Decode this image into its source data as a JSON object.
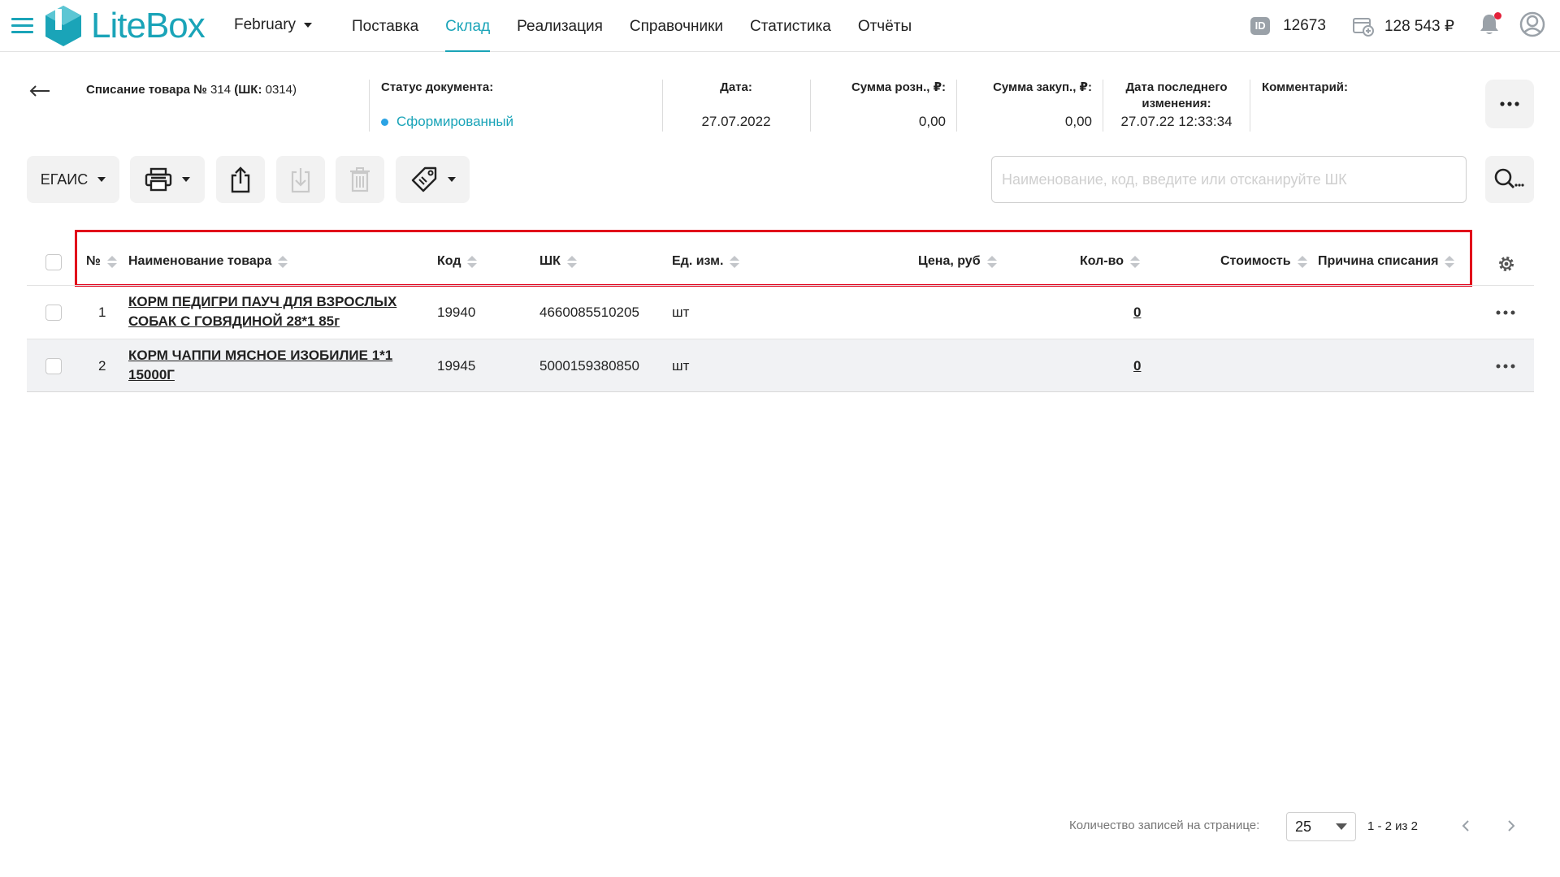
{
  "header": {
    "logo_text": "LiteBox",
    "company": "February",
    "nav": [
      {
        "label": "Поставка",
        "active": false
      },
      {
        "label": "Склад",
        "active": true
      },
      {
        "label": "Реализация",
        "active": false
      },
      {
        "label": "Справочники",
        "active": false
      },
      {
        "label": "Статистика",
        "active": false
      },
      {
        "label": "Отчёты",
        "active": false
      }
    ],
    "id_badge": "ID",
    "user_id": "12673",
    "balance": "128 543 ₽",
    "accent_color": "#1aa4b8"
  },
  "document": {
    "title_bold": "Списание товара №",
    "title_number": "314",
    "title_code_label": "(ШК:",
    "title_code": "0314)",
    "status_label": "Статус документа:",
    "status_value": "Сформированный",
    "date_label": "Дата:",
    "date_value": "27.07.2022",
    "retail_sum_label": "Сумма розн., ₽:",
    "retail_sum_value": "0,00",
    "purchase_sum_label": "Сумма закуп., ₽:",
    "purchase_sum_value": "0,00",
    "last_change_label_1": "Дата последнего",
    "last_change_label_2": "изменения:",
    "last_change_value": "27.07.22 12:33:34",
    "comment_label": "Комментарий:"
  },
  "toolbar": {
    "egais_label": "ЕГАИС",
    "search_placeholder": "Наименование, код, введите или отсканируйте ШК"
  },
  "table": {
    "columns": {
      "num": "№",
      "name": "Наименование товара",
      "code": "Код",
      "barcode": "ШК",
      "unit": "Ед. изм.",
      "price": "Цена, руб",
      "qty": "Кол-во",
      "cost": "Стоимость",
      "reason": "Причина списания"
    },
    "rows": [
      {
        "num": "1",
        "name": "КОРМ ПЕДИГРИ ПАУЧ ДЛЯ ВЗРОСЛЫХ СОБАК С ГОВЯДИНОЙ 28*1 85г",
        "code": "19940",
        "barcode": "4660085510205",
        "unit": "шт",
        "qty": "0"
      },
      {
        "num": "2",
        "name": "КОРМ ЧАППИ МЯСНОЕ ИЗОБИЛИЕ 1*1 15000Г",
        "code": "19945",
        "barcode": "5000159380850",
        "unit": "шт",
        "qty": "0"
      }
    ]
  },
  "pagination": {
    "label": "Количество записей на странице:",
    "per_page": "25",
    "range": "1 - 2 из 2"
  }
}
